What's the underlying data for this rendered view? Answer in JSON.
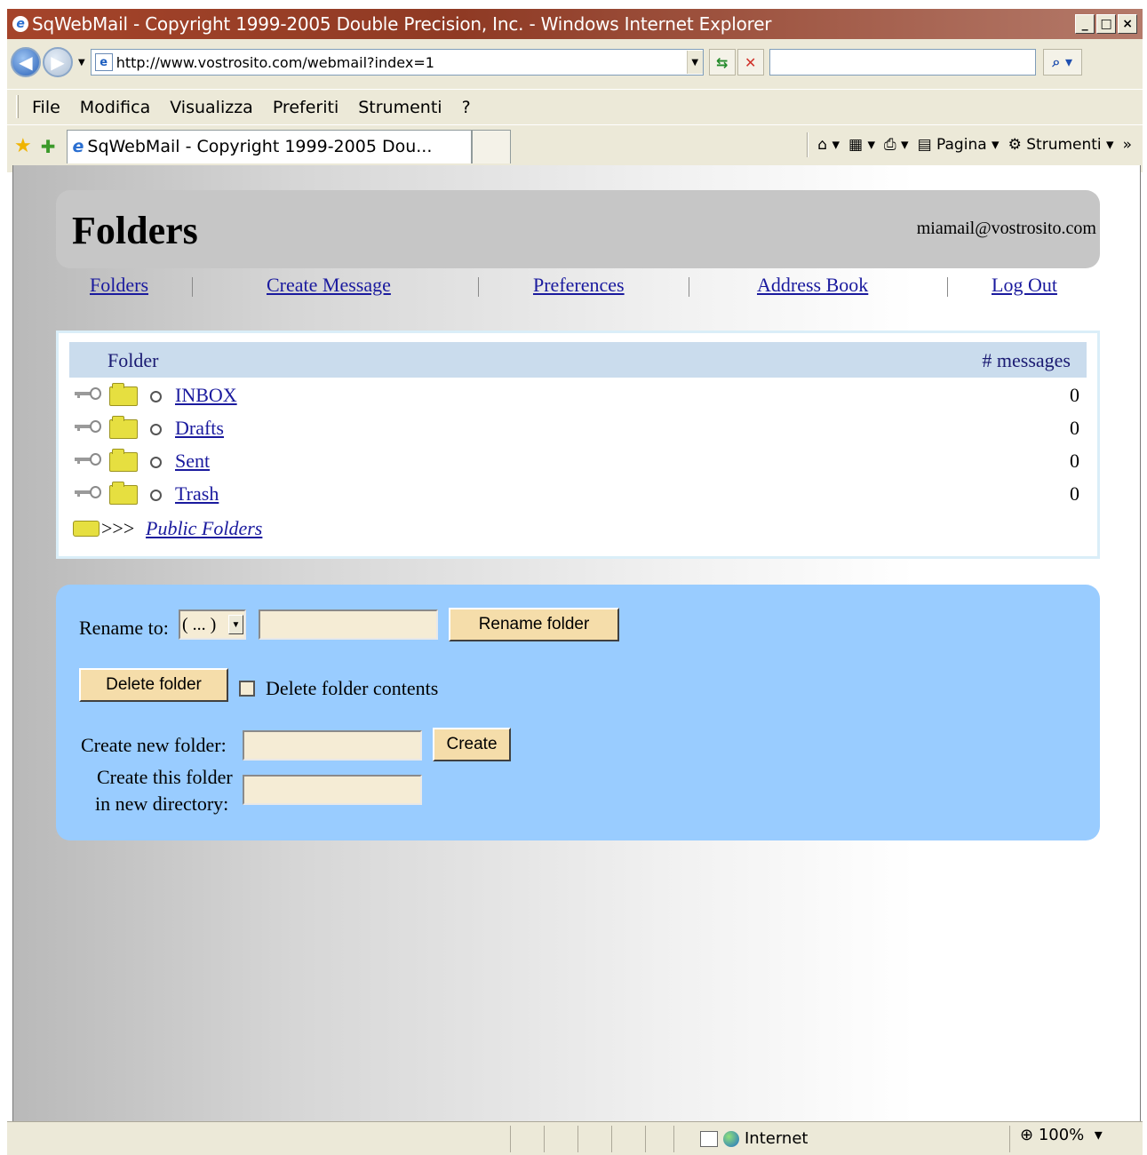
{
  "window": {
    "title": "SqWebMail - Copyright 1999-2005 Double Precision, Inc. - Windows Internet Explorer",
    "minimize": "_",
    "maximize": "□",
    "close": "×"
  },
  "addressbar": {
    "url": "http://www.vostrosito.com/webmail?index=1"
  },
  "menu": {
    "items": [
      "File",
      "Modifica",
      "Visualizza",
      "Preferiti",
      "Strumenti",
      "?"
    ]
  },
  "tabs": {
    "active_tab_label": "SqWebMail - Copyright 1999-2005 Dou..."
  },
  "commandbar": {
    "page_label": "Pagina",
    "tools_label": "Strumenti"
  },
  "page": {
    "title": "Folders",
    "user_email": "miamail@vostrosito.com",
    "nav": {
      "folders": "Folders",
      "create_message": "Create Message",
      "preferences": "Preferences",
      "address_book": "Address Book",
      "log_out": "Log Out"
    },
    "folder_table": {
      "col_folder": "Folder",
      "col_messages": "# messages",
      "rows": [
        {
          "name": "INBOX",
          "count": "0"
        },
        {
          "name": "Drafts",
          "count": "0"
        },
        {
          "name": "Sent",
          "count": "0"
        },
        {
          "name": "Trash",
          "count": "0"
        }
      ],
      "public_prefix": ">>>",
      "public_folders": "Public Folders"
    },
    "actions": {
      "rename_label": "Rename to:",
      "rename_select_value": "( ... )",
      "rename_button": "Rename folder",
      "delete_button": "Delete folder",
      "delete_contents_label": "Delete folder contents",
      "create_label": "Create new folder:",
      "create_button": "Create",
      "create_dir_label_1": "Create this folder",
      "create_dir_label_2": "in new directory:"
    }
  },
  "statusbar": {
    "zone": "Internet",
    "zoom": "100%"
  }
}
